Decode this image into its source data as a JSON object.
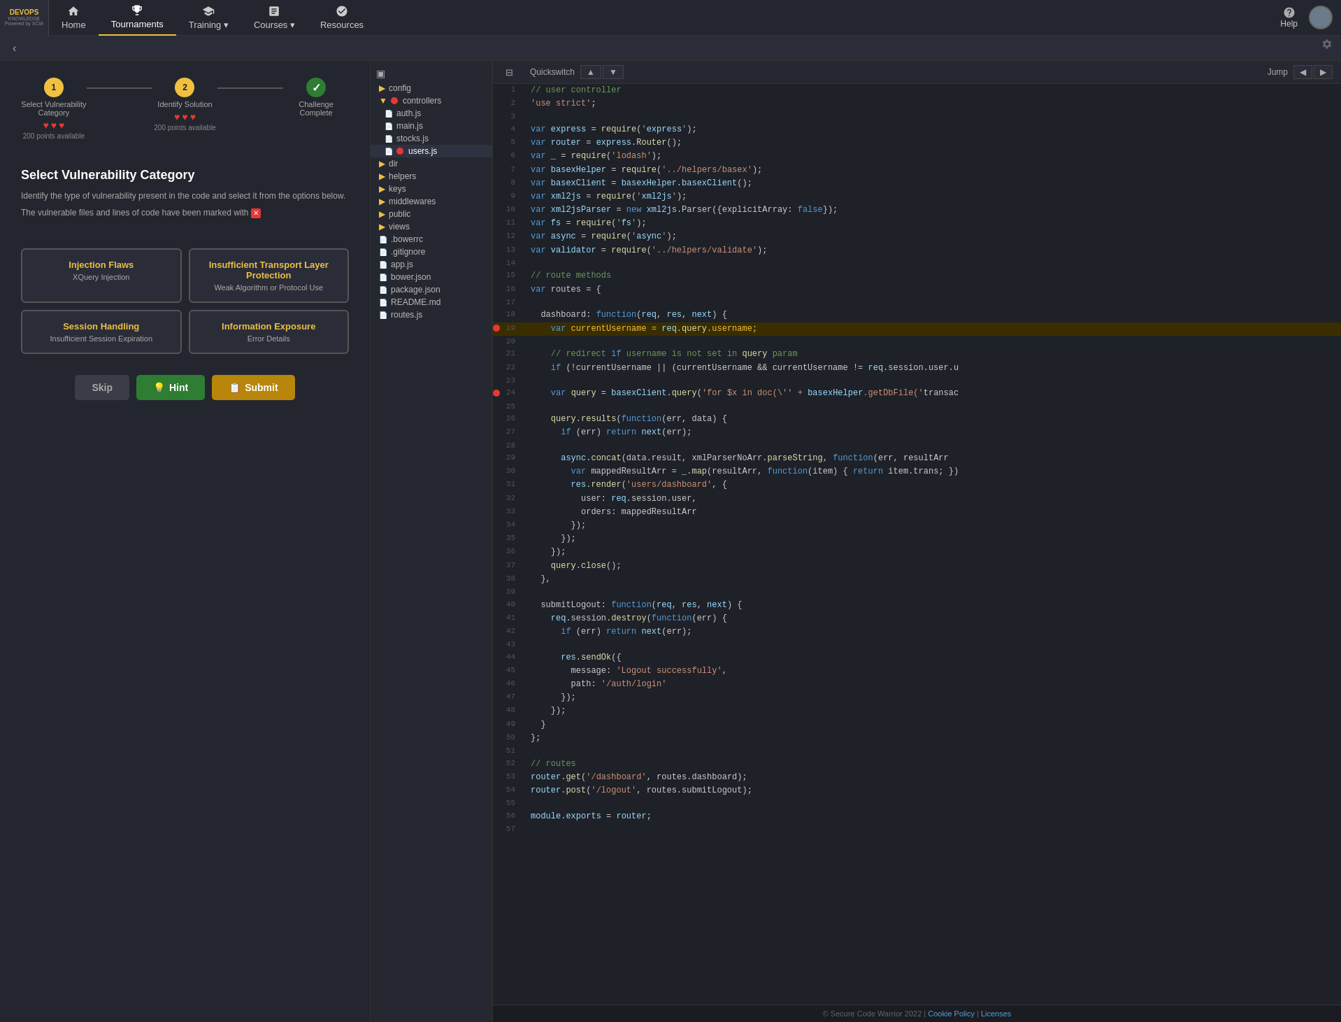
{
  "nav": {
    "logo_title": "DEVOPS",
    "logo_sub": "KNOWLEDGE",
    "items": [
      {
        "id": "home",
        "label": "Home",
        "icon": "home"
      },
      {
        "id": "tournaments",
        "label": "Tournaments",
        "icon": "trophy",
        "active": true
      },
      {
        "id": "training",
        "label": "Training",
        "icon": "training",
        "dropdown": true
      },
      {
        "id": "courses",
        "label": "Courses",
        "icon": "book",
        "dropdown": true
      },
      {
        "id": "resources",
        "label": "Resources",
        "icon": "resources"
      }
    ],
    "help_label": "Help",
    "help_dropdown": true
  },
  "progress": {
    "steps": [
      {
        "id": 1,
        "label": "Select Vulnerability Category",
        "state": "active",
        "number": "1",
        "hearts": 3,
        "max_hearts": 3,
        "points": "200 points available"
      },
      {
        "id": 2,
        "label": "Identify Solution",
        "state": "active",
        "number": "2",
        "hearts": 3,
        "max_hearts": 3,
        "points": "200 points available"
      },
      {
        "id": 3,
        "label": "Challenge Complete",
        "state": "complete",
        "number": "✓"
      }
    ]
  },
  "challenge": {
    "title": "Select Vulnerability Category",
    "desc1": "Identify the type of vulnerability present in the code and select it from the options below.",
    "desc2": "The vulnerable files and lines of code have been marked with",
    "marker_symbol": "✕"
  },
  "options": [
    {
      "id": "injection",
      "title": "Injection Flaws",
      "sub": "XQuery Injection",
      "selected": false
    },
    {
      "id": "transport",
      "title": "Insufficient Transport Layer Protection",
      "sub": "Weak Algorithm or Protocol Use",
      "selected": false
    },
    {
      "id": "session",
      "title": "Session Handling",
      "sub": "Insufficient Session Expiration",
      "selected": false
    },
    {
      "id": "information",
      "title": "Information Exposure",
      "sub": "Error Details",
      "selected": false
    }
  ],
  "buttons": {
    "skip": "Skip",
    "hint": "Hint",
    "hint_icon": "💡",
    "submit": "Submit",
    "submit_icon": "📋"
  },
  "file_tree": {
    "items": [
      {
        "id": "config",
        "label": "config",
        "type": "folder",
        "indent": 0
      },
      {
        "id": "controllers",
        "label": "controllers",
        "type": "folder",
        "indent": 0,
        "open": true,
        "error": true
      },
      {
        "id": "auth_js",
        "label": "auth.js",
        "type": "file",
        "indent": 1
      },
      {
        "id": "main_js",
        "label": "main.js",
        "type": "file",
        "indent": 1
      },
      {
        "id": "stocks_js",
        "label": "stocks.js",
        "type": "file",
        "indent": 1
      },
      {
        "id": "users_js",
        "label": "users.js",
        "type": "file",
        "indent": 1,
        "active": true,
        "error": true
      },
      {
        "id": "dir",
        "label": "dir",
        "type": "folder",
        "indent": 0
      },
      {
        "id": "helpers",
        "label": "helpers",
        "type": "folder",
        "indent": 0
      },
      {
        "id": "keys",
        "label": "keys",
        "type": "folder",
        "indent": 0
      },
      {
        "id": "middlewares",
        "label": "middlewares",
        "type": "folder",
        "indent": 0
      },
      {
        "id": "public",
        "label": "public",
        "type": "folder",
        "indent": 0
      },
      {
        "id": "views",
        "label": "views",
        "type": "folder",
        "indent": 0
      },
      {
        "id": "bowerrc",
        "label": ".bowerrc",
        "type": "file",
        "indent": 0
      },
      {
        "id": "gitignore",
        "label": ".gitignore",
        "type": "file",
        "indent": 0
      },
      {
        "id": "app_js",
        "label": "app.js",
        "type": "file",
        "indent": 0
      },
      {
        "id": "bower_json",
        "label": "bower.json",
        "type": "file",
        "indent": 0
      },
      {
        "id": "package_json",
        "label": "package.json",
        "type": "file",
        "indent": 0
      },
      {
        "id": "readme",
        "label": "README.md",
        "type": "file",
        "indent": 0
      },
      {
        "id": "routes_js",
        "label": "routes.js",
        "type": "file",
        "indent": 0
      }
    ]
  },
  "toolbar": {
    "quickswitch_label": "Quickswitch",
    "up_arrow": "▲",
    "down_arrow": "▼",
    "jump_label": "Jump",
    "prev_arrow": "◀",
    "next_arrow": "▶"
  },
  "code_lines": [
    {
      "n": 1,
      "code": "// user controller",
      "class": "c-comment",
      "error": false,
      "highlight": false
    },
    {
      "n": 2,
      "code": "'use strict';",
      "class": "c-plain",
      "error": false,
      "highlight": false
    },
    {
      "n": 3,
      "code": "",
      "class": "",
      "error": false,
      "highlight": false
    },
    {
      "n": 4,
      "code": "var express = require('express');",
      "class": "",
      "error": false,
      "highlight": false
    },
    {
      "n": 5,
      "code": "var router = express.Router();",
      "class": "",
      "error": false,
      "highlight": false
    },
    {
      "n": 6,
      "code": "var _ = require('lodash');",
      "class": "",
      "error": false,
      "highlight": false
    },
    {
      "n": 7,
      "code": "var basexHelper = require('../helpers/basex');",
      "class": "",
      "error": false,
      "highlight": false
    },
    {
      "n": 8,
      "code": "var basexClient = basexHelper.basexClient();",
      "class": "",
      "error": false,
      "highlight": false
    },
    {
      "n": 9,
      "code": "var xml2js = require('xml2js');",
      "class": "",
      "error": false,
      "highlight": false
    },
    {
      "n": 10,
      "code": "var xml2jsParser = new xml2js.Parser({explicitArray: false});",
      "class": "",
      "error": false,
      "highlight": false
    },
    {
      "n": 11,
      "code": "var fs = require('fs');",
      "class": "",
      "error": false,
      "highlight": false
    },
    {
      "n": 12,
      "code": "var async = require('async');",
      "class": "",
      "error": false,
      "highlight": false
    },
    {
      "n": 13,
      "code": "var validator = require('../helpers/validate');",
      "class": "",
      "error": false,
      "highlight": false
    },
    {
      "n": 14,
      "code": "",
      "class": "",
      "error": false,
      "highlight": false
    },
    {
      "n": 15,
      "code": "// route methods",
      "class": "c-comment",
      "error": false,
      "highlight": false
    },
    {
      "n": 16,
      "code": "var routes = {",
      "class": "",
      "error": false,
      "highlight": false
    },
    {
      "n": 17,
      "code": "",
      "class": "",
      "error": false,
      "highlight": false
    },
    {
      "n": 18,
      "code": "  dashboard: function(req, res, next) {",
      "class": "",
      "error": false,
      "highlight": false
    },
    {
      "n": 19,
      "code": "    var currentUsername = req.query.username;",
      "class": "",
      "error": true,
      "highlight": true
    },
    {
      "n": 20,
      "code": "",
      "class": "",
      "error": false,
      "highlight": false
    },
    {
      "n": 21,
      "code": "    // redirect if username is not set in query param",
      "class": "c-comment",
      "error": false,
      "highlight": false
    },
    {
      "n": 22,
      "code": "    if (!currentUsername || (currentUsername && currentUsername != req.session.user.u",
      "class": "",
      "error": false,
      "highlight": false
    },
    {
      "n": 23,
      "code": "",
      "class": "",
      "error": false,
      "highlight": false
    },
    {
      "n": 24,
      "code": "    var query = basexClient.query('for $x in doc(\\'' + basexHelper.getDbFile('transac",
      "class": "",
      "error": true,
      "highlight": false
    },
    {
      "n": 25,
      "code": "",
      "class": "",
      "error": false,
      "highlight": false
    },
    {
      "n": 26,
      "code": "    query.results(function(err, data) {",
      "class": "",
      "error": false,
      "highlight": false
    },
    {
      "n": 27,
      "code": "      if (err) return next(err);",
      "class": "",
      "error": false,
      "highlight": false
    },
    {
      "n": 28,
      "code": "",
      "class": "",
      "error": false,
      "highlight": false
    },
    {
      "n": 29,
      "code": "      async.concat(data.result, xmlParserNoArr.parseString, function(err, resultArr",
      "class": "",
      "error": false,
      "highlight": false
    },
    {
      "n": 30,
      "code": "        var mappedResultArr = _.map(resultArr, function(item) { return item.trans; })",
      "class": "",
      "error": false,
      "highlight": false
    },
    {
      "n": 31,
      "code": "        res.render('users/dashboard', {",
      "class": "",
      "error": false,
      "highlight": false
    },
    {
      "n": 32,
      "code": "          user: req.session.user,",
      "class": "",
      "error": false,
      "highlight": false
    },
    {
      "n": 33,
      "code": "          orders: mappedResultArr",
      "class": "",
      "error": false,
      "highlight": false
    },
    {
      "n": 34,
      "code": "        });",
      "class": "",
      "error": false,
      "highlight": false
    },
    {
      "n": 35,
      "code": "      });",
      "class": "",
      "error": false,
      "highlight": false
    },
    {
      "n": 36,
      "code": "    });",
      "class": "",
      "error": false,
      "highlight": false
    },
    {
      "n": 37,
      "code": "    query.close();",
      "class": "",
      "error": false,
      "highlight": false
    },
    {
      "n": 38,
      "code": "  },",
      "class": "",
      "error": false,
      "highlight": false
    },
    {
      "n": 39,
      "code": "",
      "class": "",
      "error": false,
      "highlight": false
    },
    {
      "n": 40,
      "code": "  submitLogout: function(req, res, next) {",
      "class": "",
      "error": false,
      "highlight": false
    },
    {
      "n": 41,
      "code": "    req.session.destroy(function(err) {",
      "class": "",
      "error": false,
      "highlight": false
    },
    {
      "n": 42,
      "code": "      if (err) return next(err);",
      "class": "",
      "error": false,
      "highlight": false
    },
    {
      "n": 43,
      "code": "",
      "class": "",
      "error": false,
      "highlight": false
    },
    {
      "n": 44,
      "code": "      res.sendOk({",
      "class": "",
      "error": false,
      "highlight": false
    },
    {
      "n": 45,
      "code": "        message: 'Logout successfully',",
      "class": "",
      "error": false,
      "highlight": false
    },
    {
      "n": 46,
      "code": "        path: '/auth/login'",
      "class": "",
      "error": false,
      "highlight": false
    },
    {
      "n": 47,
      "code": "      });",
      "class": "",
      "error": false,
      "highlight": false
    },
    {
      "n": 48,
      "code": "    });",
      "class": "",
      "error": false,
      "highlight": false
    },
    {
      "n": 49,
      "code": "  }",
      "class": "",
      "error": false,
      "highlight": false
    },
    {
      "n": 50,
      "code": "};",
      "class": "",
      "error": false,
      "highlight": false
    },
    {
      "n": 51,
      "code": "",
      "class": "",
      "error": false,
      "highlight": false
    },
    {
      "n": 52,
      "code": "// routes",
      "class": "c-comment",
      "error": false,
      "highlight": false
    },
    {
      "n": 53,
      "code": "router.get('/dashboard', routes.dashboard);",
      "class": "",
      "error": false,
      "highlight": false
    },
    {
      "n": 54,
      "code": "router.post('/logout', routes.submitLogout);",
      "class": "",
      "error": false,
      "highlight": false
    },
    {
      "n": 55,
      "code": "",
      "class": "",
      "error": false,
      "highlight": false
    },
    {
      "n": 56,
      "code": "module.exports = router;",
      "class": "",
      "error": false,
      "highlight": false
    },
    {
      "n": 57,
      "code": "",
      "class": "",
      "error": false,
      "highlight": false
    }
  ],
  "footer": {
    "copyright": "© Secure Code Warrior 2022 |",
    "cookie_policy": "Cookie Policy",
    "licenses": "Licenses"
  }
}
